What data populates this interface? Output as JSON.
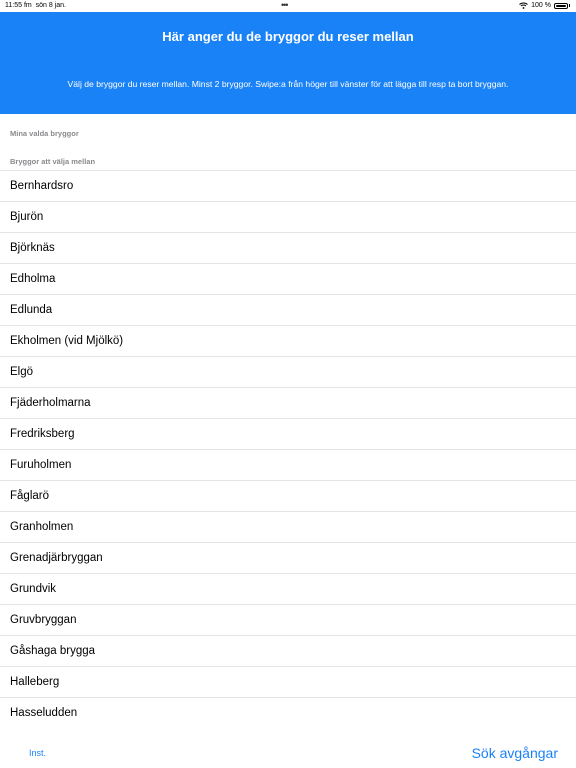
{
  "status": {
    "time": "11:55 fm",
    "date": "sön 8 jan.",
    "battery": "100 %"
  },
  "header": {
    "title": "Här anger du de bryggor du reser mellan",
    "subtitle": "Välj de bryggor du reser mellan. Minst 2 bryggor. Swipe:a från höger till vänster för att lägga till resp ta bort bryggan."
  },
  "sections": {
    "selected": "Mina valda bryggor",
    "choose": "Bryggor att välja mellan"
  },
  "items": [
    "Bernhardsro",
    "Bjurön",
    "Björknäs",
    "Edholma",
    "Edlunda",
    "Ekholmen (vid Mjölkö)",
    "Elgö",
    "Fjäderholmarna",
    "Fredriksberg",
    "Furuholmen",
    "Fåglarö",
    "Granholmen",
    "Grenadjärbryggan",
    "Grundvik",
    "Gruvbryggan",
    "Gåshaga brygga",
    "Halleberg",
    "Hasseludden"
  ],
  "toolbar": {
    "inst": "Inst.",
    "search": "Sök avgångar"
  },
  "colors": {
    "accent": "#1a82f7"
  }
}
